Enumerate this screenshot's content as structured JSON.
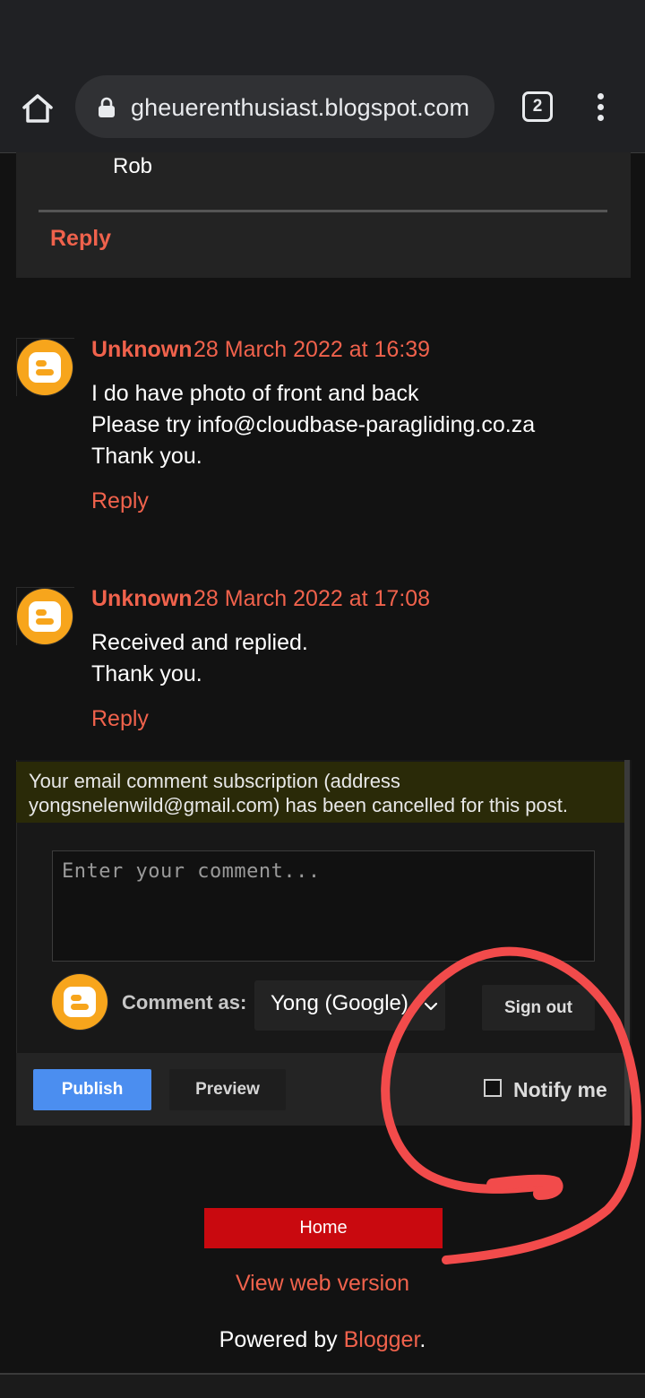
{
  "browser": {
    "url": "gheuerenthusiast.blogspot.com",
    "tab_count": "2"
  },
  "previous_comment": {
    "signature": "Rob",
    "reply_label": "Reply"
  },
  "comments": [
    {
      "author": "Unknown",
      "date": "28 March 2022 at 16:39",
      "lines": [
        "I do have photo of front and back",
        "Please try info@cloudbase-paragliding.co.za",
        "Thank you."
      ],
      "reply_label": "Reply"
    },
    {
      "author": "Unknown",
      "date": "28 March 2022 at 17:08",
      "lines": [
        "Received and replied.",
        "Thank you."
      ],
      "reply_label": "Reply"
    }
  ],
  "comment_form": {
    "notice_line1": "Your email comment subscription (address",
    "notice_line2": "yongsnelenwild@gmail.com) has been cancelled for this post.",
    "placeholder": "Enter your comment...",
    "comment_as_label": "Comment as:",
    "identity": "Yong (Google)",
    "sign_out_label": "Sign out",
    "publish_label": "Publish",
    "preview_label": "Preview",
    "notify_label": "Notify me",
    "notify_checked": false
  },
  "footer": {
    "home_label": "Home",
    "view_web_label": "View web version",
    "powered_prefix": "Powered by ",
    "powered_brand": "Blogger",
    "powered_suffix": "."
  },
  "colors": {
    "accent": "#f0624c",
    "publish": "#4b8ef0",
    "home_button": "#c9090f",
    "annotation": "#f24b4b",
    "avatar": "#f7a51c"
  }
}
